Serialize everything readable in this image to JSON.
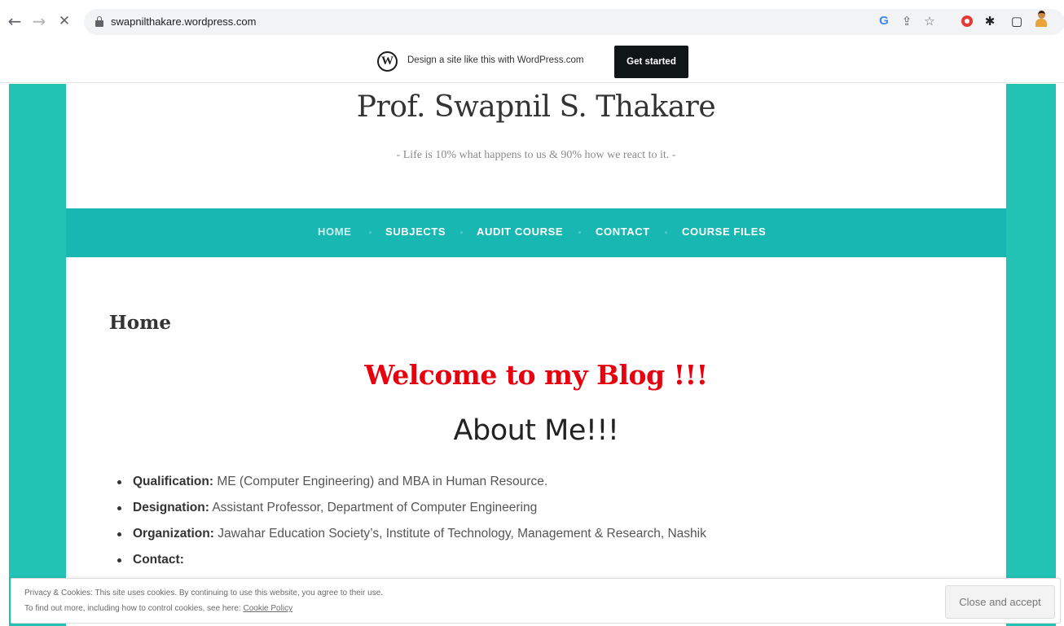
{
  "browser": {
    "url": "swapnilthakare.wordpress.com",
    "back_icon": "←",
    "forward_icon": "→",
    "close_icon": "✕",
    "google_icon": "G",
    "share_icon": "⇪",
    "star_icon": "☆",
    "puzzle_icon": "✱",
    "window_icon": "▢"
  },
  "wp_banner": {
    "logo_letter": "W",
    "text": "Design a site like this with WordPress.com",
    "button_label": "Get started"
  },
  "site": {
    "title": "Prof. Swapnil S. Thakare",
    "tagline": "- Life is 10% what happens to us & 90% how we react to it. -"
  },
  "menu": {
    "items": [
      {
        "label": "HOME"
      },
      {
        "label": "SUBJECTS"
      },
      {
        "label": "AUDIT COURSE"
      },
      {
        "label": "CONTACT"
      },
      {
        "label": "COURSE FILES"
      }
    ]
  },
  "page": {
    "heading": "Home",
    "welcome": "Welcome to my Blog !!!",
    "about": "About Me!!!",
    "details": [
      {
        "key": "Qualification:",
        "value": " ME (Computer Engineering) and MBA in Human Resource."
      },
      {
        "key": "Designation:",
        "value": " Assistant Professor, Department of Computer Engineering"
      },
      {
        "key": "Organization:",
        "value": " Jawahar Education Society’s, Institute of Technology, Management & Research, Nashik"
      },
      {
        "key": "Contact:",
        "value": ""
      }
    ]
  },
  "cookie": {
    "line1": "Privacy & Cookies: This site uses cookies. By continuing to use this website, you agree to their use.",
    "line2": "To find out more, including how to control cookies, see here: ",
    "link": "Cookie Policy",
    "button": "Close and accept"
  },
  "colors": {
    "teal_background": "#22c3b5",
    "menu_bar": "#18b7b2",
    "welcome_red": "#e8000f"
  }
}
